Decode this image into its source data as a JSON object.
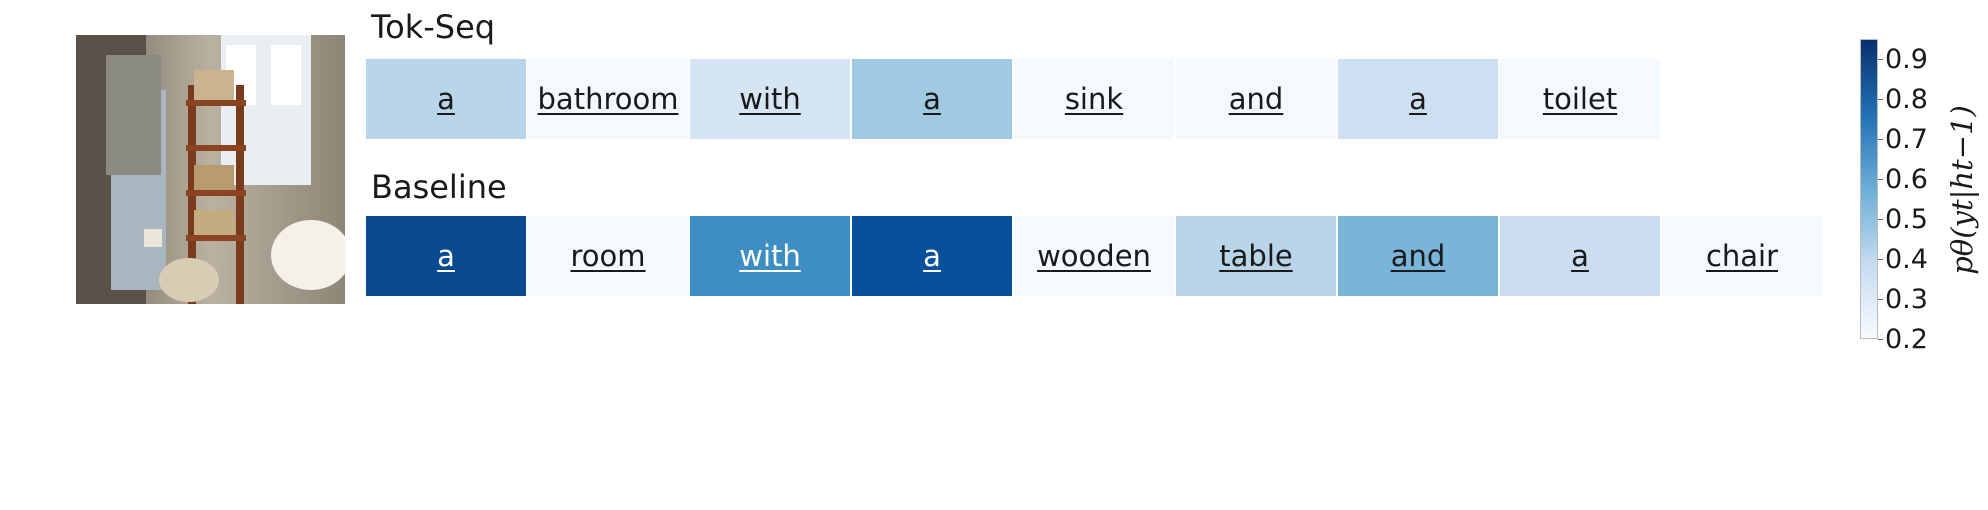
{
  "chart_data": {
    "type": "heatmap",
    "colormap": "Blues",
    "rows": [
      {
        "name": "Tok-Seq",
        "tokens": [
          "a",
          "bathroom",
          "with",
          "a",
          "sink",
          "and",
          "a",
          "toilet"
        ],
        "values": [
          0.42,
          0.21,
          0.33,
          0.48,
          0.21,
          0.21,
          0.36,
          0.21
        ]
      },
      {
        "name": "Baseline",
        "tokens": [
          "a",
          "room",
          "with",
          "a",
          "wooden",
          "table",
          "and",
          "a",
          "chair"
        ],
        "values": [
          0.88,
          0.21,
          0.68,
          0.86,
          0.21,
          0.42,
          0.55,
          0.37,
          0.21
        ]
      }
    ],
    "colorbar": {
      "ticks": [
        "0.9",
        "0.8",
        "0.7",
        "0.6",
        "0.5",
        "0.4",
        "0.3",
        "0.2"
      ],
      "range": [
        0.2,
        0.95
      ],
      "label": "pθ(yt|ht−1)"
    }
  },
  "colors": {
    "low": "#f7fbff",
    "high": "#08306b"
  },
  "image": {
    "subject": "bathroom-photo"
  }
}
